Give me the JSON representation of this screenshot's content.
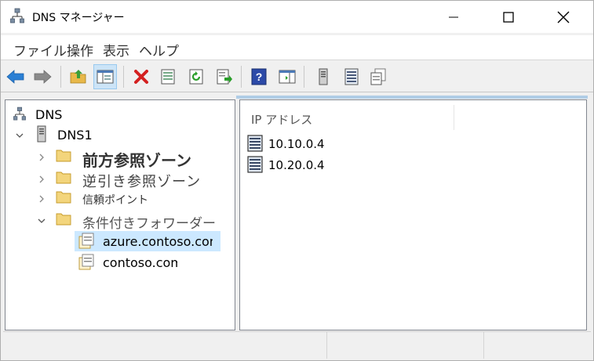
{
  "window": {
    "title": "DNS マネージャー"
  },
  "menu": {
    "items": [
      "ファイル",
      "操作",
      "表示",
      "ヘルプ"
    ]
  },
  "toolbar": {
    "buttons": [
      "back-arrow-icon",
      "forward-arrow-icon",
      "up-folder-icon",
      "show-hide-tree-icon",
      "delete-icon",
      "properties-icon",
      "refresh-icon",
      "export-list-icon",
      "help-icon",
      "action-pane-icon",
      "server-icon",
      "list-icon",
      "copy-icon"
    ]
  },
  "tree": {
    "root_label": "DNS",
    "server_label": "DNS1",
    "forward_zone_label": "前方参照ゾーン",
    "reverse_zone_label": "逆引き参照ゾーン",
    "trust_points_label": "信頼ポイント",
    "conditional_forwarders_label": "条件付きフォワーダー",
    "forwarder_1_label": "azure.contoso.com",
    "forwarder_2_label": "contoso.com"
  },
  "list": {
    "column_header": "IP アドレス",
    "rows": [
      "10.10.0.4",
      "10.20.0.4"
    ]
  },
  "colors": {
    "selection": "#cce8ff",
    "accent_strip": "#b0cde6"
  }
}
